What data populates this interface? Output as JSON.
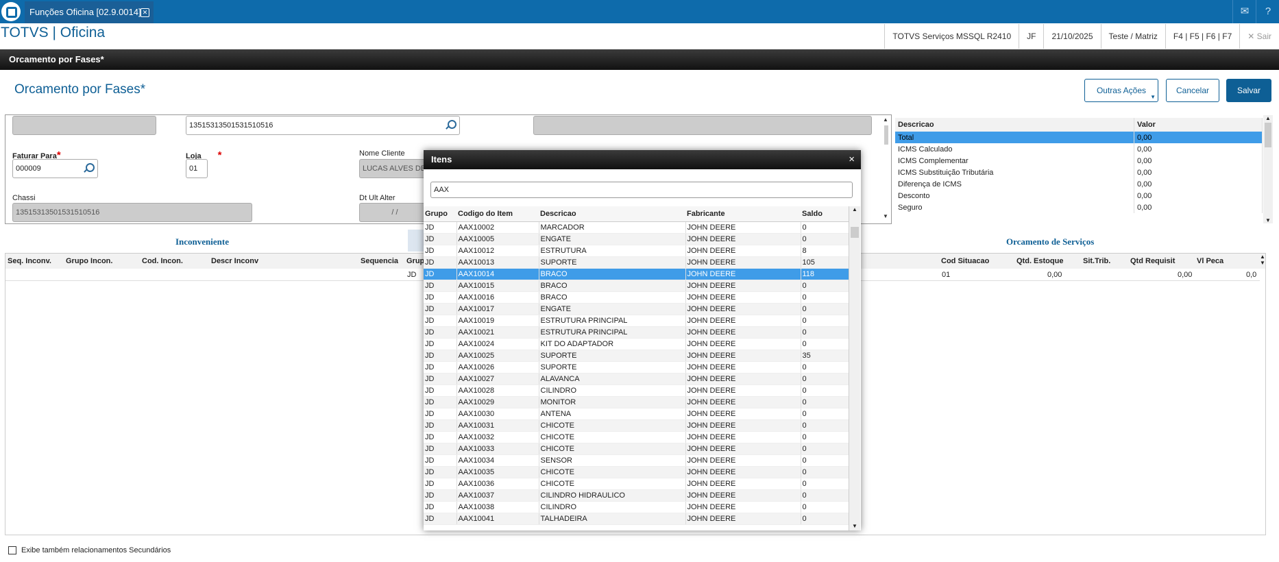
{
  "topbar": {
    "tab_title": "Funções Oficina [02.9.0014]",
    "tab_close": "✕",
    "mail_icon": "✉",
    "help_icon": "?"
  },
  "header": {
    "app_title": "TOTVS | Oficina",
    "env": "TOTVS Serviços MSSQL R2410",
    "user": "JF",
    "date": "21/10/2025",
    "company": "Teste / Matriz",
    "shortcuts": "F4 | F5 | F6 | F7",
    "logout": "Sair"
  },
  "page": {
    "header_label": "Orcamento por Fases*",
    "title": "Orcamento por Fases*",
    "buttons": {
      "other_actions": "Outras Ações",
      "cancel": "Cancelar",
      "save": "Salvar"
    }
  },
  "form": {
    "chassis_search_value": "13515313501531510516",
    "faturar_label": "Faturar Para",
    "faturar_value": "000009",
    "loja_label": "Loja",
    "loja_value": "01",
    "nome_cliente_label": "Nome Cliente",
    "nome_cliente_value": "LUCAS ALVES DE",
    "chassi_label": "Chassi",
    "chassi_value": "13515313501531510516",
    "dt_ult_alter_label": "Dt Ult Alter",
    "dt_ult_alter_value": "  /  /"
  },
  "totals": {
    "columns": [
      "Descricao",
      "Valor"
    ],
    "rows": [
      [
        "Total",
        "0,00"
      ],
      [
        "ICMS Calculado",
        "0,00"
      ],
      [
        "ICMS Complementar",
        "0,00"
      ],
      [
        "ICMS Substituição Tributária",
        "0,00"
      ],
      [
        "Diferença de ICMS",
        "0,00"
      ],
      [
        "Desconto",
        "0,00"
      ],
      [
        "Seguro",
        "0,00"
      ]
    ]
  },
  "sections": {
    "inconveniente": "Inconveniente",
    "orcamento_servicos": "Orcamento de Serviços"
  },
  "grid": {
    "headers_left": [
      "Seq. Inconv.",
      "Grupo Incon.",
      "Cod. Incon.",
      "Descr Inconv",
      "Sequencia",
      "Grup"
    ],
    "headers_right": [
      "Cod Situacao",
      "Qtd. Estoque",
      "Sit.Trib.",
      "Qtd Requisit",
      "Vl Peca"
    ],
    "row_left": [
      "JD"
    ],
    "row_right": [
      "01",
      "0,00",
      "",
      "0,00",
      "0,0"
    ]
  },
  "modal": {
    "title": "Itens",
    "close": "×",
    "search_value": "AAX",
    "columns": [
      "Grupo",
      "Codigo do Item",
      "Descricao",
      "Fabricante",
      "Saldo"
    ],
    "selected_index": 4,
    "rows": [
      [
        "JD",
        "AAX10002",
        "MARCADOR",
        "JOHN DEERE",
        "0"
      ],
      [
        "JD",
        "AAX10005",
        "ENGATE",
        "JOHN DEERE",
        "0"
      ],
      [
        "JD",
        "AAX10012",
        "ESTRUTURA",
        "JOHN DEERE",
        "8"
      ],
      [
        "JD",
        "AAX10013",
        "SUPORTE",
        "JOHN DEERE",
        "105"
      ],
      [
        "JD",
        "AAX10014",
        "BRACO",
        "JOHN DEERE",
        "118"
      ],
      [
        "JD",
        "AAX10015",
        "BRACO",
        "JOHN DEERE",
        "0"
      ],
      [
        "JD",
        "AAX10016",
        "BRACO",
        "JOHN DEERE",
        "0"
      ],
      [
        "JD",
        "AAX10017",
        "ENGATE",
        "JOHN DEERE",
        "0"
      ],
      [
        "JD",
        "AAX10019",
        "ESTRUTURA PRINCIPAL",
        "JOHN DEERE",
        "0"
      ],
      [
        "JD",
        "AAX10021",
        "ESTRUTURA PRINCIPAL",
        "JOHN DEERE",
        "0"
      ],
      [
        "JD",
        "AAX10024",
        "KIT DO ADAPTADOR",
        "JOHN DEERE",
        "0"
      ],
      [
        "JD",
        "AAX10025",
        "SUPORTE",
        "JOHN DEERE",
        "35"
      ],
      [
        "JD",
        "AAX10026",
        "SUPORTE",
        "JOHN DEERE",
        "0"
      ],
      [
        "JD",
        "AAX10027",
        "ALAVANCA",
        "JOHN DEERE",
        "0"
      ],
      [
        "JD",
        "AAX10028",
        "CILINDRO",
        "JOHN DEERE",
        "0"
      ],
      [
        "JD",
        "AAX10029",
        "MONITOR",
        "JOHN DEERE",
        "0"
      ],
      [
        "JD",
        "AAX10030",
        "ANTENA",
        "JOHN DEERE",
        "0"
      ],
      [
        "JD",
        "AAX10031",
        "CHICOTE",
        "JOHN DEERE",
        "0"
      ],
      [
        "JD",
        "AAX10032",
        "CHICOTE",
        "JOHN DEERE",
        "0"
      ],
      [
        "JD",
        "AAX10033",
        "CHICOTE",
        "JOHN DEERE",
        "0"
      ],
      [
        "JD",
        "AAX10034",
        "SENSOR",
        "JOHN DEERE",
        "0"
      ],
      [
        "JD",
        "AAX10035",
        "CHICOTE",
        "JOHN DEERE",
        "0"
      ],
      [
        "JD",
        "AAX10036",
        "CHICOTE",
        "JOHN DEERE",
        "0"
      ],
      [
        "JD",
        "AAX10037",
        "CILINDRO HIDRAULICO",
        "JOHN DEERE",
        "0"
      ],
      [
        "JD",
        "AAX10038",
        "CILINDRO",
        "JOHN DEERE",
        "0"
      ],
      [
        "JD",
        "AAX10041",
        "TALHADEIRA",
        "JOHN DEERE",
        "0"
      ]
    ]
  },
  "footer": {
    "secondary_label": "Exibe também relacionamentos Secundários"
  },
  "colors": {
    "brand": "#0e6bab",
    "selection": "#3f9ce8",
    "required": "#dd0000"
  }
}
